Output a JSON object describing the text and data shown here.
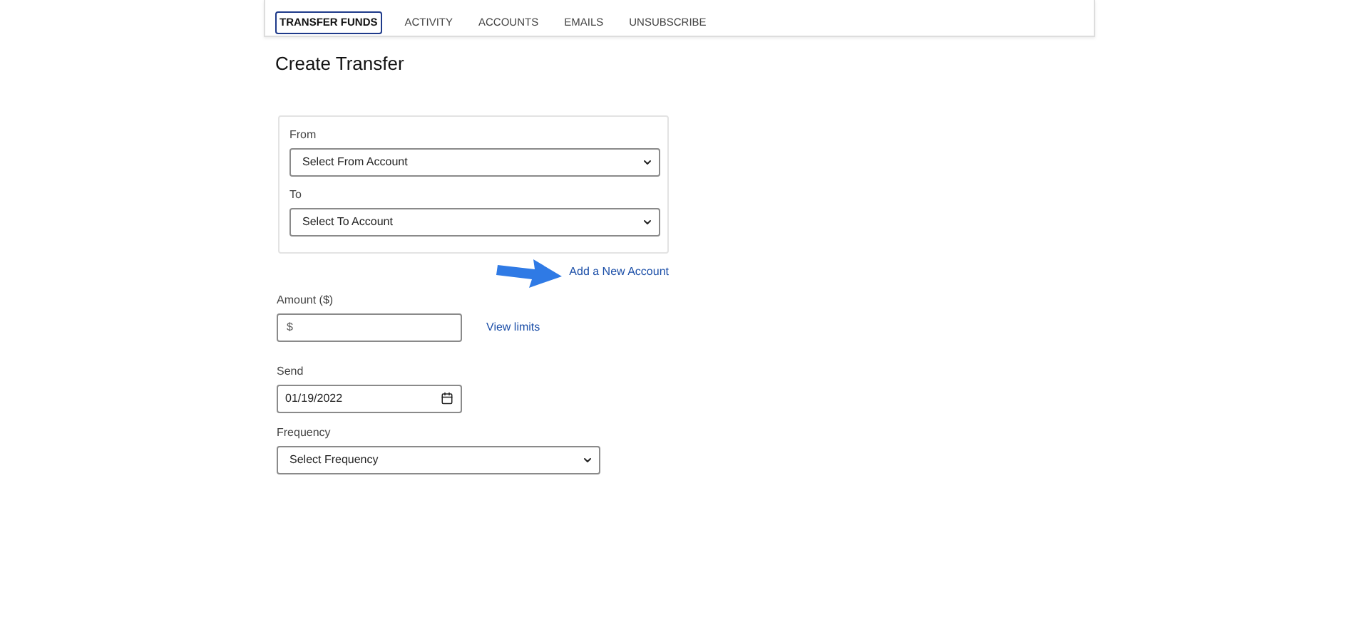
{
  "tabs": [
    {
      "label": "TRANSFER FUNDS",
      "selected": true
    },
    {
      "label": "ACTIVITY",
      "selected": false
    },
    {
      "label": "ACCOUNTS",
      "selected": false
    },
    {
      "label": "EMAILS",
      "selected": false
    },
    {
      "label": "UNSUBSCRIBE",
      "selected": false
    }
  ],
  "title": "Create Transfer",
  "accounts": {
    "from": {
      "label": "From",
      "value": "Select From Account"
    },
    "to": {
      "label": "To",
      "value": "Select To Account"
    },
    "add_link": "Add a New Account"
  },
  "amount": {
    "label": "Amount ($)",
    "value": "$",
    "link": "View limits"
  },
  "send": {
    "label": "Send",
    "value": "01/19/2022"
  },
  "frequency": {
    "label": "Frequency",
    "value": "Select Frequency"
  }
}
